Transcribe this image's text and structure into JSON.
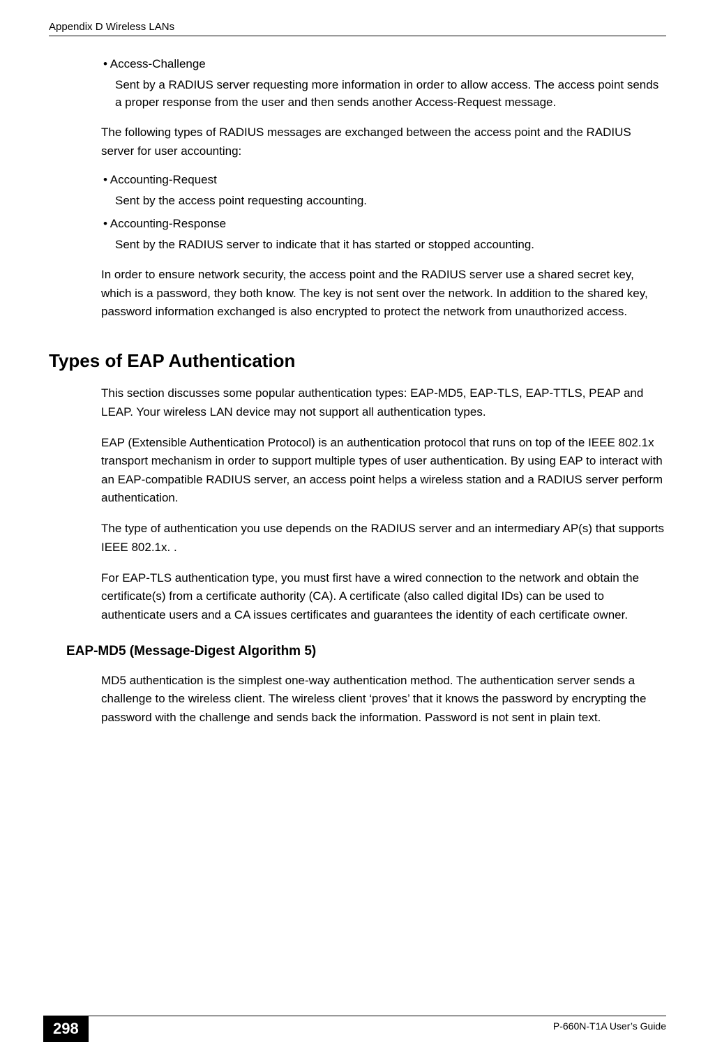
{
  "header": {
    "left": "Appendix D Wireless LANs",
    "right": ""
  },
  "body": {
    "bullet1_label": "Access-Challenge",
    "bullet1_body": "Sent by a RADIUS server requesting more information in order to allow access. The access point sends a proper response from the user and then sends another Access-Request message.",
    "para1": "The following types of RADIUS messages are exchanged between the access point and the RADIUS server for user accounting:",
    "bullet2_label": "Accounting-Request",
    "bullet2_body": "Sent by the access point requesting accounting.",
    "bullet3_label": "Accounting-Response",
    "bullet3_body": "Sent by the RADIUS server to indicate that it has started or stopped accounting.",
    "para2": "In order to ensure network security, the access point and the RADIUS server use a shared secret key, which is a password, they both know. The key is not sent over the network. In addition to the shared key, password information exchanged is also encrypted to protect the network from unauthorized access.",
    "section_title": "Types of EAP Authentication",
    "para3": "This section discusses some popular authentication types: EAP-MD5, EAP-TLS, EAP-TTLS, PEAP and LEAP. Your wireless LAN device may not support all authentication types.",
    "para4": "EAP (Extensible Authentication Protocol) is an authentication protocol that runs on top of the IEEE 802.1x transport mechanism in order to support multiple types of user authentication. By using EAP to interact with an EAP-compatible RADIUS server, an access point helps a wireless station and a RADIUS server perform authentication.",
    "para5": "The type of authentication you use depends on the RADIUS server and an intermediary AP(s) that supports IEEE 802.1x. .",
    "para6": "For EAP-TLS authentication type, you must first have a wired connection to the network and obtain the certificate(s) from a certificate authority (CA). A certificate (also called digital IDs) can be used to authenticate users and a CA issues certificates and guarantees the identity of each certificate owner.",
    "subsection_title": "EAP-MD5 (Message-Digest Algorithm 5)",
    "para7": "MD5 authentication is the simplest one-way authentication method. The authentication server sends a challenge to the wireless client. The wireless client ‘proves’ that it knows the password by encrypting the password with the challenge and sends back the information. Password is not sent in plain text."
  },
  "footer": {
    "page_number": "298",
    "guide": "P-660N-T1A User’s Guide"
  }
}
